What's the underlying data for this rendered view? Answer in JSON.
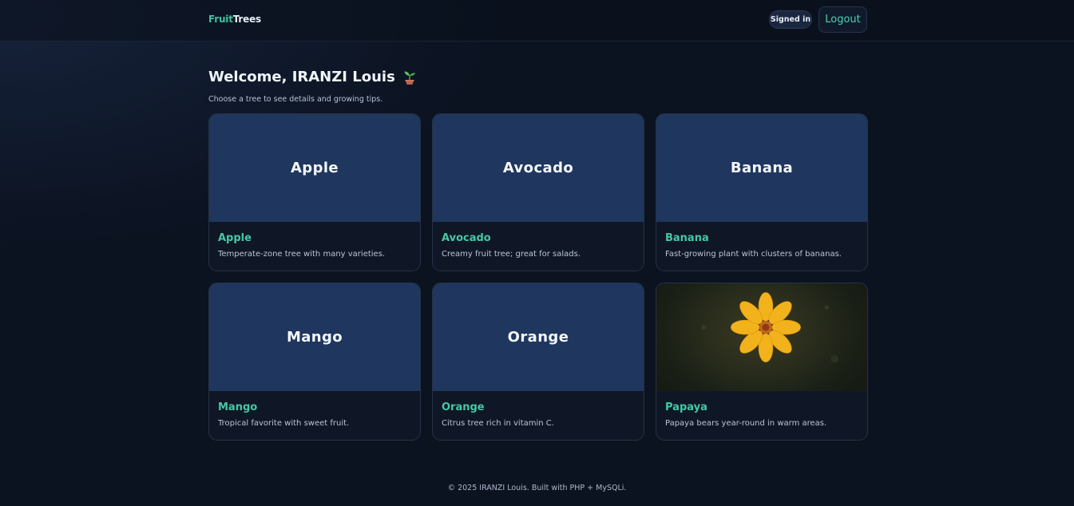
{
  "header": {
    "brand_part1": "Fruit",
    "brand_part2": "Trees",
    "status_badge": "Signed in",
    "logout_label": "Logout"
  },
  "main": {
    "welcome": "Welcome, IRANZI Louis",
    "welcome_icon": "seedling-icon",
    "subtitle": "Choose a tree to see details and growing tips."
  },
  "trees": [
    {
      "thumb_label": "Apple",
      "name": "Apple",
      "description": "Temperate-zone tree with many varieties."
    },
    {
      "thumb_label": "Avocado",
      "name": "Avocado",
      "description": "Creamy fruit tree; great for salads."
    },
    {
      "thumb_label": "Banana",
      "name": "Banana",
      "description": "Fast-growing plant with clusters of bananas."
    },
    {
      "thumb_label": "Mango",
      "name": "Mango",
      "description": "Tropical favorite with sweet fruit."
    },
    {
      "thumb_label": "Orange",
      "name": "Orange",
      "description": "Citrus tree rich in vitamin C."
    },
    {
      "image": "yellow-flower-photo",
      "name": "Papaya",
      "description": "Papaya bears year-round in warm areas."
    }
  ],
  "footer": {
    "text": "© 2025 IRANZI Louis. Built with PHP + MySQLi."
  },
  "colors": {
    "accent": "#45c8a4",
    "background": "#0b1220",
    "card_placeholder": "#1f365e"
  }
}
